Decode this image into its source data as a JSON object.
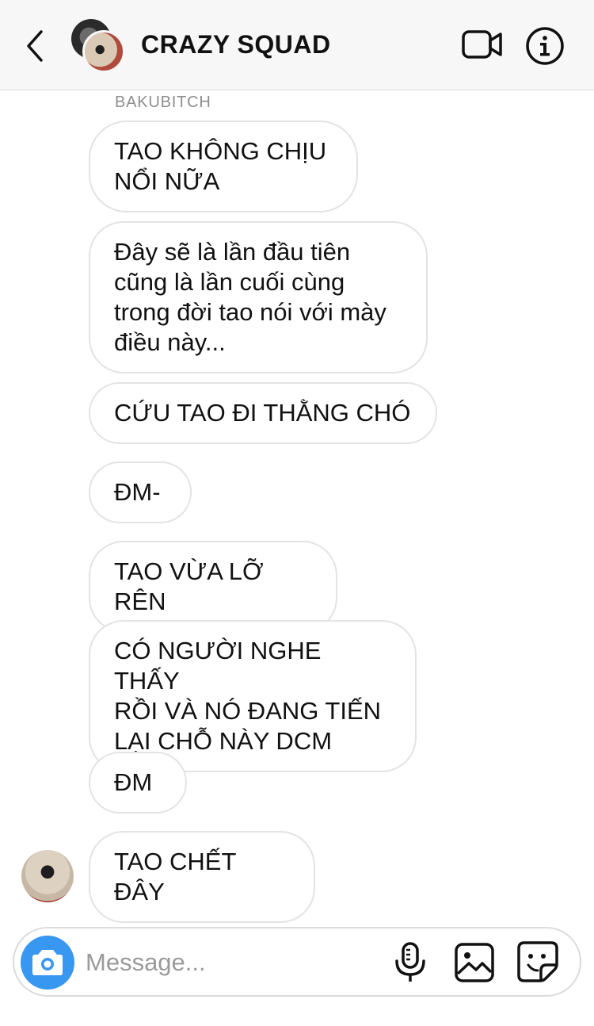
{
  "header": {
    "title": "CRAZY SQUAD",
    "back_icon": "chevron-left-icon",
    "video_icon": "video-camera-icon",
    "info_icon": "info-icon"
  },
  "conversation": {
    "sender_name": "BAKUBITCH",
    "messages": [
      {
        "text": "TAO KHÔNG CHỊU\nNỔI NỮA"
      },
      {
        "text": "Đây sẽ là lần đầu tiên\ncũng là lần cuối cùng\ntrong đời tao nói với mày\nđiều này..."
      },
      {
        "text": "CỨU TAO ĐI THẰNG CHÓ"
      },
      {
        "text": "ĐM-"
      },
      {
        "text": "TAO VỪA LỠ RÊN"
      },
      {
        "text": "CÓ NGƯỜI NGHE THẤY\nRỒI VÀ NÓ ĐANG TIẾN\nLẠI CHỖ NÀY DCM"
      },
      {
        "text": "ĐM"
      },
      {
        "text": "TAO CHẾT ĐÂY"
      }
    ]
  },
  "composer": {
    "placeholder": "Message...",
    "icons": [
      "camera-icon",
      "microphone-icon",
      "gallery-icon",
      "sticker-icon"
    ]
  },
  "colors": {
    "accent": "#3897f0",
    "bubble_border": "#e3e3e3",
    "header_bg": "#f7f7f7"
  }
}
